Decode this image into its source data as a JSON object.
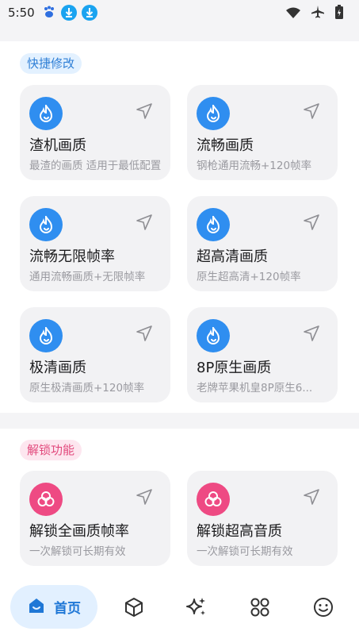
{
  "status": {
    "time": "5:50"
  },
  "quick_section": {
    "label": "快捷修改",
    "cards": [
      {
        "title": "渣机画质",
        "subtitle": "最渣的画质 适用于最低配置"
      },
      {
        "title": "流畅画质",
        "subtitle": "钢枪通用流畅+120帧率"
      },
      {
        "title": "流畅无限帧率",
        "subtitle": "通用流畅画质+无限帧率"
      },
      {
        "title": "超高清画质",
        "subtitle": "原生超高清+120帧率"
      },
      {
        "title": "极清画质",
        "subtitle": "原生极清画质+120帧率"
      },
      {
        "title": "8P原生画质",
        "subtitle": "老牌苹果机皇8P原生6..."
      }
    ]
  },
  "unlock_section": {
    "label": "解锁功能",
    "cards": [
      {
        "title": "解锁全画质帧率",
        "subtitle": "一次解锁可长期有效"
      },
      {
        "title": "解锁超高音质",
        "subtitle": "一次解锁可长期有效"
      }
    ]
  },
  "nav": {
    "home_label": "首页"
  },
  "colors": {
    "accent_blue": "#2f8ef0",
    "accent_pink": "#ee4a83"
  }
}
